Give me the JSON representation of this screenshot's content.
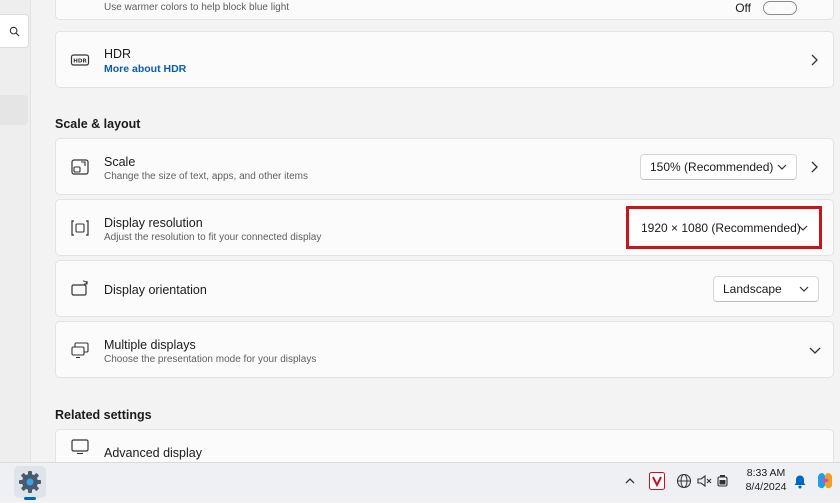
{
  "night_light": {
    "subtitle": "Use warmer colors to help block blue light",
    "toggle_label": "Off"
  },
  "hdr": {
    "title": "HDR",
    "link": "More about HDR"
  },
  "scale_layout": {
    "section_title": "Scale & layout",
    "scale": {
      "title": "Scale",
      "subtitle": "Change the size of text, apps, and other items",
      "value": "150% (Recommended)"
    },
    "resolution": {
      "title": "Display resolution",
      "subtitle": "Adjust the resolution to fit your connected display",
      "value": "1920 × 1080 (Recommended)"
    },
    "orientation": {
      "title": "Display orientation",
      "value": "Landscape"
    },
    "multiple": {
      "title": "Multiple displays",
      "subtitle": "Choose the presentation mode for your displays"
    }
  },
  "related": {
    "section_title": "Related settings",
    "advanced": {
      "title": "Advanced display"
    }
  },
  "taskbar": {
    "time": "8:33 AM",
    "date": "8/4/2024"
  },
  "colors": {
    "highlight": "#c4161c",
    "link": "#0b5cad",
    "accent": "#0067c0"
  }
}
